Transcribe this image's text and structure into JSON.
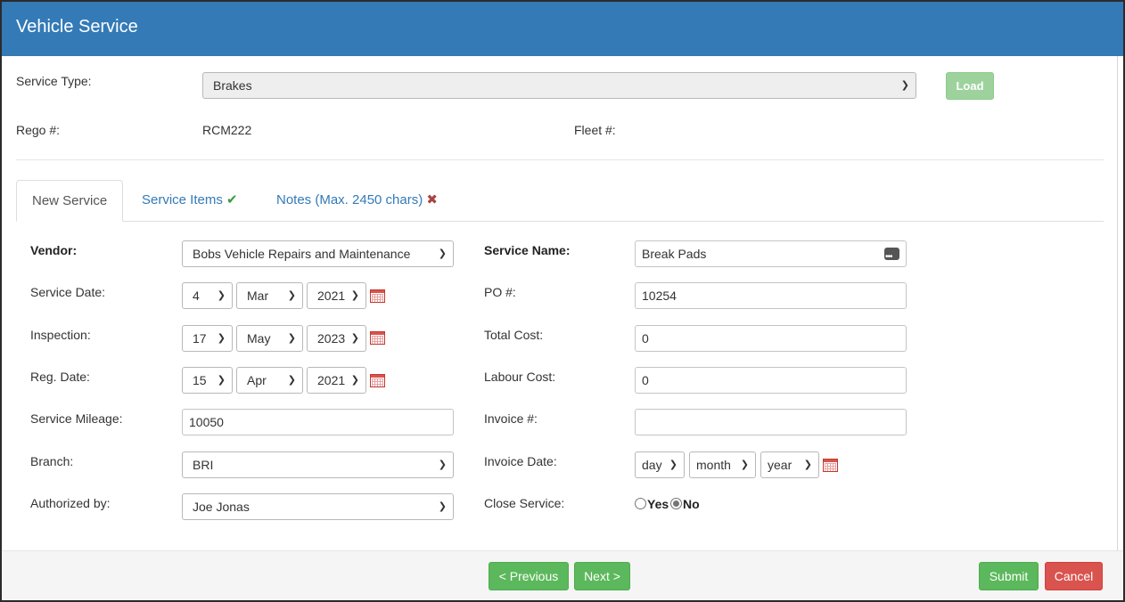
{
  "window": {
    "title": "Vehicle Service"
  },
  "header": {
    "service_type_label": "Service Type:",
    "service_type_value": "Brakes",
    "load_label": "Load",
    "rego_label": "Rego #:",
    "rego_value": "RCM222",
    "fleet_label": "Fleet #:"
  },
  "tabs": [
    {
      "label": "New Service",
      "active": true
    },
    {
      "label": "Service Items",
      "status_icon": "✔"
    },
    {
      "label": "Notes (Max. 2450 chars)",
      "status_icon": "✖"
    }
  ],
  "form": {
    "vendor": {
      "label": "Vendor:",
      "value": "Bobs Vehicle Repairs and Maintenance"
    },
    "service_date": {
      "label": "Service Date:",
      "day": "4",
      "month": "Mar",
      "year": "2021"
    },
    "inspection": {
      "label": "Inspection:",
      "day": "17",
      "month": "May",
      "year": "2023"
    },
    "reg_date": {
      "label": "Reg. Date:",
      "day": "15",
      "month": "Apr",
      "year": "2021"
    },
    "service_mileage": {
      "label": "Service Mileage:",
      "value": "10050"
    },
    "branch": {
      "label": "Branch:",
      "value": "BRI"
    },
    "authorized_by": {
      "label": "Authorized by:",
      "value": "Joe Jonas"
    },
    "service_name": {
      "label": "Service Name:",
      "value": "Break Pads"
    },
    "po": {
      "label": "PO #:",
      "value": "10254"
    },
    "total_cost": {
      "label": "Total Cost:",
      "value": "0"
    },
    "labour_cost": {
      "label": "Labour Cost:",
      "value": "0"
    },
    "invoice_no": {
      "label": "Invoice #:",
      "value": ""
    },
    "invoice_date": {
      "label": "Invoice Date:",
      "day": "day",
      "month": "month",
      "year": "year"
    },
    "close_service": {
      "label": "Close Service:",
      "yes": "Yes",
      "no": "No",
      "selected": "No"
    }
  },
  "footer": {
    "previous_label": "< Previous",
    "next_label": "Next >",
    "submit_label": "Submit",
    "cancel_label": "Cancel"
  },
  "icons": {
    "calendar": "calendar-icon",
    "chevron": "chevron-down-icon",
    "ellipsis": "ellipsis-icon",
    "check": "check-icon",
    "cross": "cross-icon"
  },
  "colors": {
    "header_bg": "#337ab7",
    "success": "#5cb85c",
    "danger": "#d9534f",
    "link": "#337ab7"
  }
}
